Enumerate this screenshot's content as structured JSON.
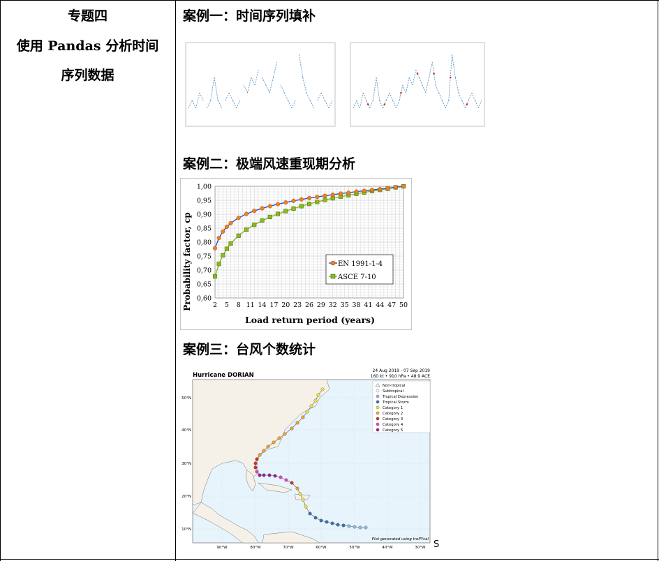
{
  "topic": {
    "line1": "专题四",
    "line2": "使用 Pandas 分析时间",
    "line3": "序列数据"
  },
  "cases": [
    {
      "title": "案例一：时间序列填补"
    },
    {
      "title": "案例二：极端风速重现期分析"
    },
    {
      "title": "案例三：台风个数统计"
    }
  ],
  "chart_data": [
    {
      "type": "line",
      "title": "",
      "xlabel": "",
      "ylabel": "",
      "note": "time series with gaps",
      "series": [
        {
          "values": [
            2,
            3,
            2,
            4,
            3,
            2,
            3,
            6,
            3,
            2,
            3,
            4,
            3,
            2,
            3,
            5,
            4,
            6,
            5,
            7,
            6,
            5,
            4,
            6,
            8,
            5,
            4,
            3,
            2,
            3,
            9,
            6,
            4,
            3,
            2,
            3,
            4,
            3,
            2,
            3
          ]
        }
      ]
    },
    {
      "type": "line",
      "title": "",
      "xlabel": "",
      "ylabel": "",
      "note": "filled time series",
      "series": [
        {
          "values": [
            2,
            3,
            2,
            4,
            3,
            2,
            3,
            6,
            3,
            2,
            3,
            4,
            3,
            2,
            3,
            5,
            4,
            6,
            5,
            7,
            6,
            5,
            4,
            6,
            8,
            5,
            4,
            3,
            2,
            3,
            9,
            6,
            4,
            3,
            2,
            3,
            4,
            3,
            2,
            3
          ]
        }
      ]
    },
    {
      "type": "line",
      "xlabel": "Load return period (years)",
      "ylabel": "Probability factor, cp",
      "ylim": [
        0.6,
        1.0
      ],
      "xlim": [
        2,
        50
      ],
      "y_ticks": [
        "0,60",
        "0,65",
        "0,70",
        "0,75",
        "0,80",
        "0,85",
        "0,90",
        "0,95",
        "1,00"
      ],
      "x_ticks": [
        "2",
        "5",
        "8",
        "11",
        "14",
        "17",
        "20",
        "23",
        "26",
        "29",
        "32",
        "35",
        "38",
        "41",
        "44",
        "47",
        "50"
      ],
      "legend": "inside-lower-right",
      "series": [
        {
          "name": "EN 1991-1-4",
          "color": "#f08020",
          "x": [
            2,
            3,
            4,
            5,
            6,
            8,
            10,
            12,
            14,
            16,
            18,
            20,
            22,
            24,
            26,
            28,
            30,
            32,
            34,
            36,
            38,
            40,
            42,
            44,
            46,
            48,
            50
          ],
          "values": [
            0.778,
            0.815,
            0.838,
            0.855,
            0.868,
            0.887,
            0.901,
            0.912,
            0.921,
            0.929,
            0.936,
            0.942,
            0.948,
            0.953,
            0.958,
            0.962,
            0.966,
            0.97,
            0.974,
            0.977,
            0.981,
            0.984,
            0.987,
            0.99,
            0.993,
            0.997,
            1.0
          ]
        },
        {
          "name": "ASCE 7-10",
          "color": "#8ab820",
          "x": [
            2,
            3,
            4,
            5,
            6,
            8,
            10,
            12,
            14,
            16,
            18,
            20,
            22,
            24,
            26,
            28,
            30,
            32,
            34,
            36,
            38,
            40,
            42,
            44,
            46,
            48,
            50
          ],
          "values": [
            0.677,
            0.722,
            0.753,
            0.776,
            0.795,
            0.823,
            0.845,
            0.862,
            0.877,
            0.89,
            0.901,
            0.911,
            0.92,
            0.929,
            0.937,
            0.944,
            0.951,
            0.957,
            0.963,
            0.968,
            0.973,
            0.978,
            0.983,
            0.987,
            0.991,
            0.996,
            1.0
          ]
        }
      ]
    }
  ],
  "map": {
    "title": "Hurricane DORIAN",
    "dates": "24 Aug 2019 - 07 Sep 2019",
    "stats": "160 kt • 910 hPa • 48.9 ACE",
    "footer": "Plot generated using troPYcal",
    "legend": [
      {
        "label": "Non-tropical",
        "color": "#ffffff"
      },
      {
        "label": "Subtropical",
        "color": "#ffffff"
      },
      {
        "label": "Tropical Depression",
        "color": "#8fb7e0"
      },
      {
        "label": "Tropical Storm",
        "color": "#3a6fb0"
      },
      {
        "label": "Category 1",
        "color": "#f0e040"
      },
      {
        "label": "Category 2",
        "color": "#f0a030"
      },
      {
        "label": "Category 3",
        "color": "#d03020"
      },
      {
        "label": "Category 4",
        "color": "#e040d0"
      },
      {
        "label": "Category 5",
        "color": "#9a1a9a"
      }
    ],
    "lat_labels": [
      "50°N",
      "40°N",
      "30°N",
      "20°N",
      "10°N"
    ],
    "lon_labels": [
      "90°W",
      "80°W",
      "70°W",
      "60°W",
      "50°W",
      "40°W",
      "30°W"
    ]
  },
  "stray_mark": "S"
}
